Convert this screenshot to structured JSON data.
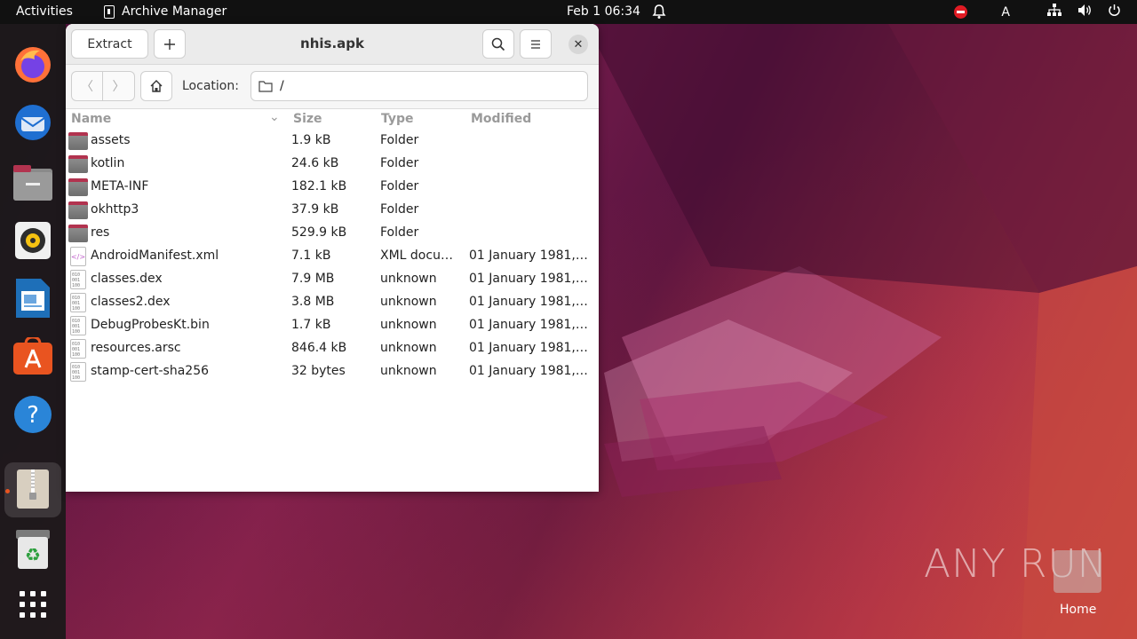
{
  "topbar": {
    "activities": "Activities",
    "app_name": "Archive Manager",
    "clock": "Feb 1  06:34",
    "input_indicator": "A"
  },
  "dock": {
    "items": [
      "firefox-icon",
      "thunderbird-icon",
      "files-icon",
      "rhythmbox-icon",
      "libreoffice-writer-icon",
      "app-center-icon",
      "help-icon",
      "archive-manager-icon",
      "trash-icon",
      "show-apps-icon"
    ]
  },
  "window": {
    "title": "nhis.apk",
    "extract_label": "Extract",
    "location_label": "Location:",
    "location_value": "/",
    "columns": {
      "name": "Name",
      "size": "Size",
      "type": "Type",
      "modified": "Modified"
    },
    "files": [
      {
        "name": "assets",
        "size": "1.9 kB",
        "type": "Folder",
        "modified": "",
        "icon": "folder"
      },
      {
        "name": "kotlin",
        "size": "24.6 kB",
        "type": "Folder",
        "modified": "",
        "icon": "folder"
      },
      {
        "name": "META-INF",
        "size": "182.1 kB",
        "type": "Folder",
        "modified": "",
        "icon": "folder"
      },
      {
        "name": "okhttp3",
        "size": "37.9 kB",
        "type": "Folder",
        "modified": "",
        "icon": "folder"
      },
      {
        "name": "res",
        "size": "529.9 kB",
        "type": "Folder",
        "modified": "",
        "icon": "folder"
      },
      {
        "name": "AndroidManifest.xml",
        "size": "7.1 kB",
        "type": "XML docu…",
        "modified": "01 January 1981,…",
        "icon": "xml"
      },
      {
        "name": "classes.dex",
        "size": "7.9 MB",
        "type": "unknown",
        "modified": "01 January 1981,…",
        "icon": "binary"
      },
      {
        "name": "classes2.dex",
        "size": "3.8 MB",
        "type": "unknown",
        "modified": "01 January 1981,…",
        "icon": "binary"
      },
      {
        "name": "DebugProbesKt.bin",
        "size": "1.7 kB",
        "type": "unknown",
        "modified": "01 January 1981,…",
        "icon": "binary"
      },
      {
        "name": "resources.arsc",
        "size": "846.4 kB",
        "type": "unknown",
        "modified": "01 January 1981,…",
        "icon": "binary"
      },
      {
        "name": "stamp-cert-sha256",
        "size": "32 bytes",
        "type": "unknown",
        "modified": "01 January 1981,…",
        "icon": "binary"
      }
    ]
  },
  "desktop": {
    "watermark": "ANY RUN",
    "home_label": "Home"
  }
}
